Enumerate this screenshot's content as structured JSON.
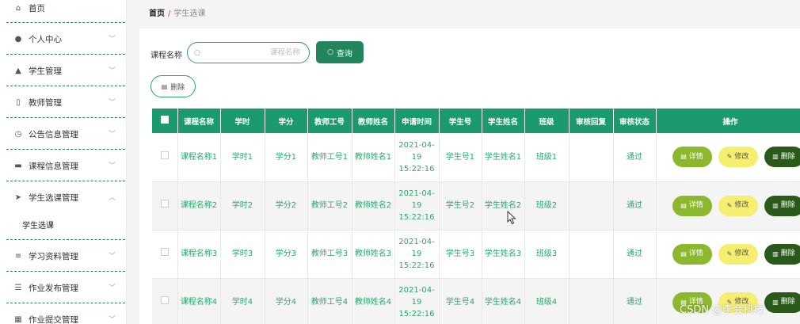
{
  "sidebar": {
    "items": [
      {
        "label": "首页",
        "icon": "home-icon",
        "glyph": "⌂"
      },
      {
        "label": "个人中心",
        "icon": "user-icon",
        "glyph": "●"
      },
      {
        "label": "学生管理",
        "icon": "thumb-icon",
        "glyph": "▲"
      },
      {
        "label": "教师管理",
        "icon": "phone-icon",
        "glyph": "▯"
      },
      {
        "label": "公告信息管理",
        "icon": "clock-icon",
        "glyph": "◷"
      },
      {
        "label": "课程信息管理",
        "icon": "printer-icon",
        "glyph": "▬"
      },
      {
        "label": "学生选课管理",
        "icon": "send-icon",
        "glyph": "➤"
      },
      {
        "label": "学习资料管理",
        "icon": "sliders-icon",
        "glyph": "≡"
      },
      {
        "label": "作业发布管理",
        "icon": "list-icon",
        "glyph": "☰"
      },
      {
        "label": "作业提交管理",
        "icon": "grid-icon",
        "glyph": "▦"
      }
    ],
    "sub_item": "学生选课"
  },
  "breadcrumb": {
    "home": "首页",
    "separator": "/",
    "current": "学生选课"
  },
  "search": {
    "label": "课程名称",
    "placeholder": "课程名称",
    "query_button": "查询"
  },
  "toolbar": {
    "delete_button": "删除"
  },
  "table": {
    "headers": [
      "课程名称",
      "学时",
      "学分",
      "教师工号",
      "教师姓名",
      "申请时间",
      "学生号",
      "学生姓名",
      "班级",
      "审核回复",
      "审核状态",
      "操作"
    ],
    "rows": [
      {
        "course": "课程名称1",
        "hours": "学时1",
        "credit": "学分1",
        "teacher_no": "教师工号1",
        "teacher_name": "教师姓名1",
        "time": "2021-04-19 15:22:16",
        "student_no": "学生号1",
        "student_name": "学生姓名1",
        "class": "班级1",
        "reply": "",
        "status": "通过"
      },
      {
        "course": "课程名称2",
        "hours": "学时2",
        "credit": "学分2",
        "teacher_no": "教师工号2",
        "teacher_name": "教师姓名2",
        "time": "2021-04-19 15:22:16",
        "student_no": "学生号2",
        "student_name": "学生姓名2",
        "class": "班级2",
        "reply": "",
        "status": "通过"
      },
      {
        "course": "课程名称3",
        "hours": "学时3",
        "credit": "学分3",
        "teacher_no": "教师工号3",
        "teacher_name": "教师姓名3",
        "time": "2021-04-19 15:22:16",
        "student_no": "学生号3",
        "student_name": "学生姓名3",
        "class": "班级3",
        "reply": "",
        "status": "通过"
      },
      {
        "course": "课程名称4",
        "hours": "学时4",
        "credit": "学分4",
        "teacher_no": "教师工号4",
        "teacher_name": "教师姓名4",
        "time": "2021-04-19 15:22:16",
        "student_no": "学生号4",
        "student_name": "学生姓名4",
        "class": "班级4",
        "reply": "",
        "status": "通过"
      }
    ],
    "actions": {
      "detail": "详情",
      "edit": "修改",
      "delete": "删除"
    }
  },
  "watermark": "CSDN @李会科技",
  "colors": {
    "accent": "#1b9a6e",
    "detail": "#8cb82e",
    "edit": "#f5ee6e",
    "delete": "#2a5a1a",
    "text_green": "#2aa76b"
  }
}
